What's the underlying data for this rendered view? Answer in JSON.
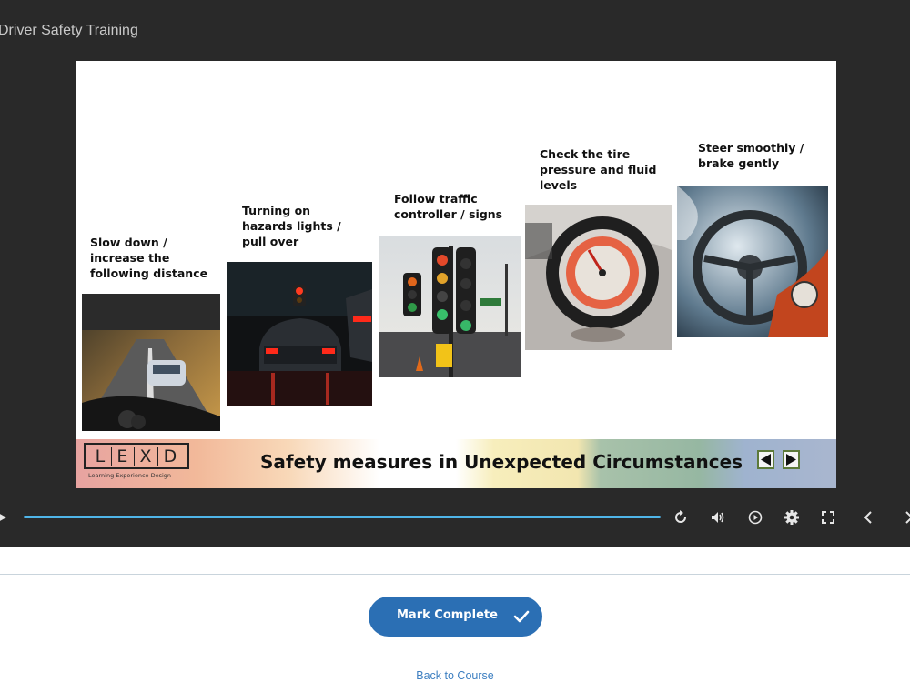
{
  "player": {
    "title": "Driver Safety Training"
  },
  "slide": {
    "steps": [
      {
        "caption": "Slow down /\nincrease the\nfollowing distance",
        "image_icon": "road-driving-photo-icon"
      },
      {
        "caption": "Turning on\nhazards lights /\npull over",
        "image_icon": "hazard-lights-photo-icon"
      },
      {
        "caption": "Follow traffic\ncontroller / signs",
        "image_icon": "traffic-light-photo-icon"
      },
      {
        "caption": "Check the tire\npressure and fluid\nlevels",
        "image_icon": "tire-gauge-photo-icon"
      },
      {
        "caption": "Steer smoothly /\nbrake gently",
        "image_icon": "steering-wheel-photo-icon"
      }
    ],
    "banner": {
      "logo_letters": [
        "L",
        "E",
        "X",
        "D"
      ],
      "logo_subtitle": "Learning Experience Design",
      "title": "Safety measures in Unexpected Circumstances"
    }
  },
  "controls": {
    "icons": [
      "play-icon",
      "replay-icon",
      "volume-icon",
      "autoplay-icon",
      "settings-icon",
      "fullscreen-icon",
      "previous-icon",
      "next-icon"
    ]
  },
  "actions": {
    "mark_complete": "Mark Complete",
    "back_to_course": "Back to Course"
  },
  "colors": {
    "player_bg": "#292929",
    "progress": "#4fb5e8",
    "primary_button": "#2b6fb4",
    "link": "#3d7fc1"
  }
}
